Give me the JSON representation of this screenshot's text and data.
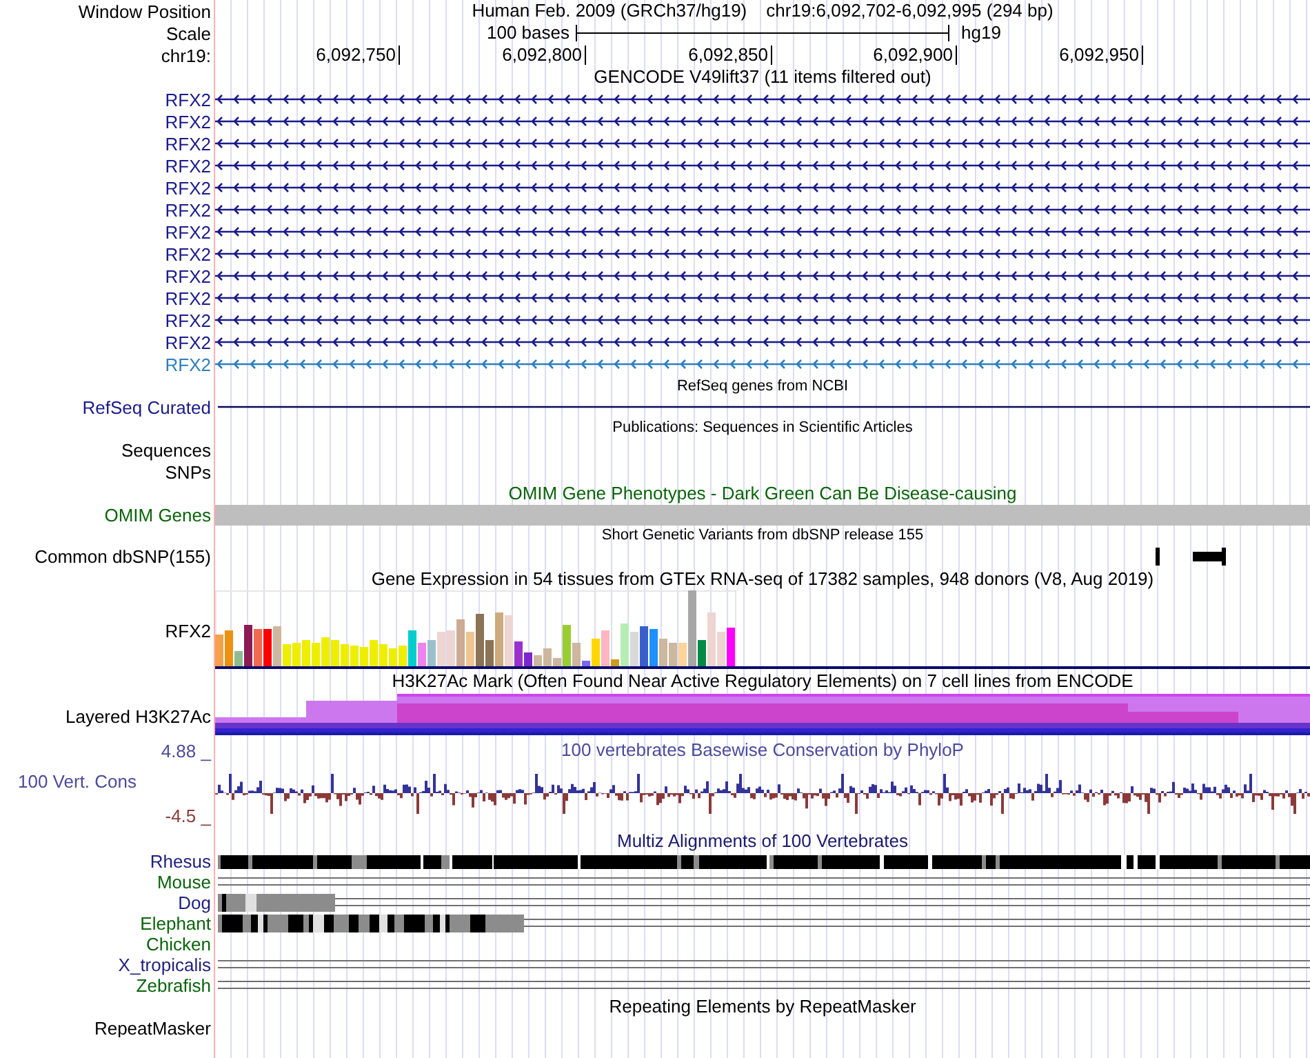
{
  "header": {
    "label": "Window Position",
    "assembly": "Human Feb. 2009 (GRCh37/hg19)",
    "position": "chr19:6,092,702-6,092,995 (294 bp)"
  },
  "scale": {
    "label": "Scale",
    "bar_label": "100 bases",
    "assembly": "hg19"
  },
  "ruler": {
    "label": "chr19:",
    "ticks": [
      "6,092,750",
      "6,092,800",
      "6,092,850",
      "6,092,900",
      "6,092,950"
    ]
  },
  "tracks": [
    {
      "kind": "genes",
      "title": "GENCODE V49lift37 (11 items filtered out)",
      "items": [
        {
          "name": "RFX2",
          "selected": false
        },
        {
          "name": "RFX2",
          "selected": false
        },
        {
          "name": "RFX2",
          "selected": false
        },
        {
          "name": "RFX2",
          "selected": false
        },
        {
          "name": "RFX2",
          "selected": false
        },
        {
          "name": "RFX2",
          "selected": false
        },
        {
          "name": "RFX2",
          "selected": false
        },
        {
          "name": "RFX2",
          "selected": false
        },
        {
          "name": "RFX2",
          "selected": false
        },
        {
          "name": "RFX2",
          "selected": false
        },
        {
          "name": "RFX2",
          "selected": false
        },
        {
          "name": "RFX2",
          "selected": false
        },
        {
          "name": "RFX2",
          "selected": true
        }
      ]
    },
    {
      "kind": "line",
      "title": "RefSeq genes from NCBI",
      "label": "RefSeq Curated"
    },
    {
      "kind": "empty",
      "title": "Publications: Sequences in Scientific Articles",
      "labels": [
        "Sequences",
        "SNPs"
      ]
    },
    {
      "kind": "bar",
      "title": "OMIM Gene Phenotypes - Dark Green Can Be Disease-causing",
      "label": "OMIM Genes"
    },
    {
      "kind": "variants",
      "title": "Short Genetic Variants from dbSNP release 155",
      "label": "Common dbSNP(155)"
    },
    {
      "kind": "expression",
      "title": "Gene Expression in 54 tissues from GTEx RNA-seq of 17382 samples, 948 donors (V8, Aug 2019)",
      "label": "RFX2"
    },
    {
      "kind": "layered",
      "title": "H3K27Ac Mark (Often Found Near Active Regulatory Elements) on 7 cell lines from ENCODE",
      "label": "Layered H3K27Ac"
    },
    {
      "kind": "wiggle",
      "title": "100 vertebrates Basewise Conservation by PhyloP",
      "label": "100 Vert. Cons",
      "max": "4.88 _",
      "min": "-4.5 _"
    },
    {
      "kind": "alignments",
      "title": "Multiz Alignments of 100 Vertebrates",
      "species": [
        {
          "name": "Rhesus",
          "color": "#1f1f7f",
          "kind": "aligned"
        },
        {
          "name": "Mouse",
          "color": "#0a640a",
          "kind": "gap"
        },
        {
          "name": "Dog",
          "color": "#1f1f7f",
          "kind": "partial"
        },
        {
          "name": "Elephant",
          "color": "#0a640a",
          "kind": "partial"
        },
        {
          "name": "Chicken",
          "color": "#0a640a",
          "kind": "none"
        },
        {
          "name": "X_tropicalis",
          "color": "#1f1f7f",
          "kind": "gap"
        },
        {
          "name": "Zebrafish",
          "color": "#0a640a",
          "kind": "gap"
        }
      ]
    },
    {
      "kind": "empty",
      "title": "Repeating Elements by RepeatMasker",
      "labels": [
        "RepeatMasker"
      ]
    }
  ]
}
